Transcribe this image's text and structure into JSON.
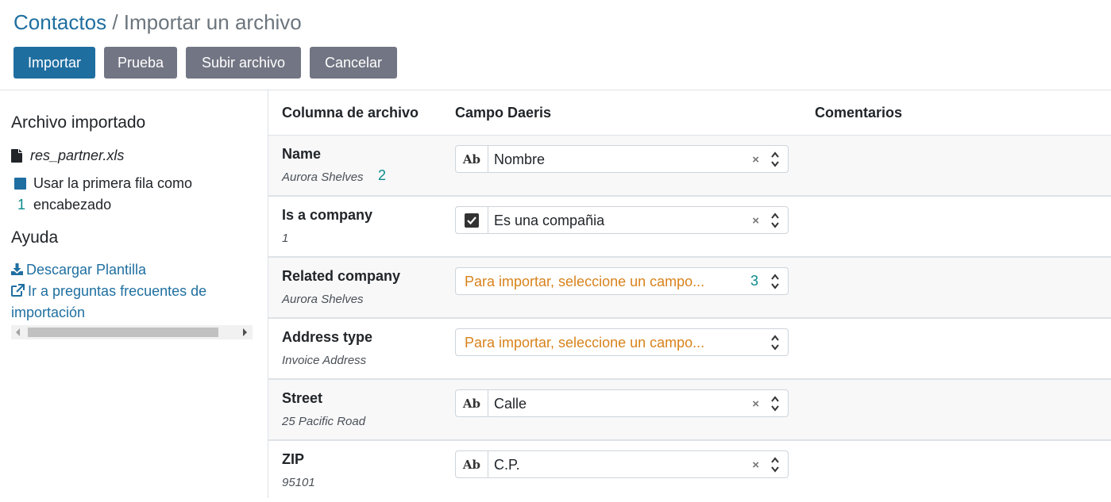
{
  "breadcrumb": {
    "parent": "Contactos",
    "separator": "/",
    "current": "Importar un archivo"
  },
  "toolbar": {
    "import_label": "Importar",
    "test_label": "Prueba",
    "upload_label": "Subir archivo",
    "cancel_label": "Cancelar"
  },
  "sidebar": {
    "imported_title": "Archivo importado",
    "file_name": "res_partner.xls",
    "header_checkbox_label": "Usar la primera fila como encabezado",
    "header_checkbox_checked": true,
    "help_title": "Ayuda",
    "download_template_label": "Descargar Plantilla",
    "faq_label": "Ir a preguntas frecuentes de importación"
  },
  "annotations": [
    "1",
    "2",
    "3"
  ],
  "table": {
    "headers": [
      "Columna de archivo",
      "Campo Daeris",
      "Comentarios"
    ],
    "rows": [
      {
        "column": "Name",
        "sample": "Aurora Shelves",
        "field_icon": "text-type-icon",
        "field_value": "Nombre",
        "placeholder": ""
      },
      {
        "column": "Is a company",
        "sample": "1",
        "field_icon": "checkbox-type-icon",
        "field_value": "Es una compañia",
        "placeholder": ""
      },
      {
        "column": "Related company",
        "sample": "Aurora Shelves",
        "field_icon": "",
        "field_value": "",
        "placeholder": "Para importar, seleccione un campo..."
      },
      {
        "column": "Address type",
        "sample": "Invoice Address",
        "field_icon": "",
        "field_value": "",
        "placeholder": "Para importar, seleccione un campo..."
      },
      {
        "column": "Street",
        "sample": "25 Pacific Road",
        "field_icon": "text-type-icon",
        "field_value": "Calle",
        "placeholder": ""
      },
      {
        "column": "ZIP",
        "sample": "95101",
        "field_icon": "text-type-icon",
        "field_value": "C.P.",
        "placeholder": ""
      }
    ]
  },
  "colors": {
    "primary": "#1f6ea0",
    "secondary": "#727583",
    "link": "#1f6fa0",
    "placeholder": "#d8821b",
    "annotation": "#0b8a8a"
  },
  "icons": {
    "clear": "×",
    "type_text": "Ab"
  }
}
